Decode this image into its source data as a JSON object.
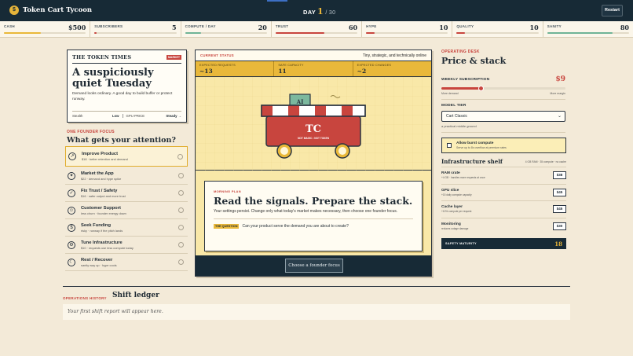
{
  "app": {
    "title": "Token Cart Tycoon",
    "logo_text": "$",
    "day_prefix": "DAY",
    "day_current": "1",
    "day_total": "/ 30",
    "restart_label": "Restart"
  },
  "stats": [
    {
      "label": "CASH",
      "value": "$500",
      "fill": 0.45,
      "color": "#e9b83a"
    },
    {
      "label": "SUBSCRIBERS",
      "value": "5",
      "fill": 0.03,
      "color": "#c8453e"
    },
    {
      "label": "COMPUTE / DAY",
      "value": "20",
      "fill": 0.2,
      "color": "#6fb396"
    },
    {
      "label": "TRUST",
      "value": "60",
      "fill": 0.6,
      "color": "#c8453e"
    },
    {
      "label": "HYPE",
      "value": "10",
      "fill": 0.1,
      "color": "#c8453e"
    },
    {
      "label": "QUALITY",
      "value": "10",
      "fill": 0.1,
      "color": "#c8453e"
    },
    {
      "label": "SANITY",
      "value": "80",
      "fill": 0.8,
      "color": "#6fb396"
    }
  ],
  "news": {
    "paper": "THE TOKEN TIMES",
    "badge": "MARKET",
    "headline": "A suspiciously quiet Tuesday",
    "body": "Demand looks ordinary. A good day to build buffer or protect runway.",
    "f1_label": "Stealth",
    "f1_value": "Low",
    "f2_label": "GPU PRICE",
    "f2_value": "Steady →"
  },
  "focus": {
    "kicker": "ONE FOUNDER FOCUS",
    "title": "What gets your attention?",
    "options": [
      {
        "icon": "↗",
        "icon_name": "trend-up-icon",
        "label": "Improve Product",
        "sub": "$18 · better retention and demand"
      },
      {
        "icon": "✦",
        "icon_name": "sparkle-icon",
        "label": "Market the App",
        "sub": "$22 · demand and hype spike"
      },
      {
        "icon": "✓",
        "icon_name": "check-icon",
        "label": "Fix Trust / Safety",
        "sub": "$16 · safer output and more trust"
      },
      {
        "icon": "☺",
        "icon_name": "smile-icon",
        "label": "Customer Support",
        "sub": "less churn · founder energy down"
      },
      {
        "icon": "$",
        "icon_name": "dollar-icon",
        "label": "Seek Funding",
        "sub": "risky · runway if the pitch lands"
      },
      {
        "icon": "⚙",
        "icon_name": "gear-icon",
        "label": "Tune Infrastructure",
        "sub": "$10 · requests use less compute today"
      },
      {
        "icon": "☾",
        "icon_name": "moon-icon",
        "label": "Rest / Recover",
        "sub": "sanity way up · hype cools"
      }
    ]
  },
  "center": {
    "status": "CURRENT STATUS",
    "tagline": "Tiny, strategic, and technically online",
    "metrics": [
      {
        "label": "EXPECTED REQUESTS",
        "value": "~13"
      },
      {
        "label": "SAFE CAPACITY",
        "value": "11"
      },
      {
        "label": "EXPECTED CHANGES",
        "value": "~2"
      }
    ],
    "cart_logo": "TC",
    "cart_sub": "NOT MAGIC • NOT TOKEN",
    "cart_sign": "AI",
    "plan_kicker": "MORNING PLAN",
    "plan_title": "Read the signals. Prepare the stack.",
    "plan_body": "Your settings persist. Change only what today's market makes necessary, then choose one founder focus.",
    "question_tag": "THE QUESTION",
    "question_text": "Can your product serve the demand you are about to create?",
    "choose_label": "Choose a founder focus"
  },
  "desk": {
    "kicker": "OPERATING DESK",
    "title": "Price & stack",
    "sub_label": "WEEKLY SUBSCRIPTION",
    "sub_price": "$9",
    "sub_level": 0.32,
    "slider_low": "More demand",
    "slider_high": "More margin",
    "tier_label": "MODEL TIER",
    "tier_value": "Cart Classic",
    "tier_note": "a practical middle ground",
    "burst_label": "Allow burst compute",
    "burst_sub": "Serve up to 8x overflow at premium rates",
    "infra_title": "Infrastructure shelf",
    "infra_meta": "4 GB RAM · 35 compute · no cache",
    "infra": [
      {
        "name": "RAM crate",
        "sub": "+4 GB · handles more requests at once",
        "price": "$38"
      },
      {
        "name": "GPU slice",
        "sub": "+15 daily compute capacity",
        "price": "$45"
      },
      {
        "name": "Cache layer",
        "sub": "+10% compute per request",
        "price": "$45"
      },
      {
        "name": "Monitoring",
        "sub": "reduces outage damage",
        "price": "$30"
      }
    ],
    "safety_label": "SAFETY MATURITY",
    "safety_value": "18"
  },
  "history": {
    "kicker": "OPERATIONS HISTORY",
    "title": "Shift ledger",
    "empty": "Your first shift report will appear here."
  }
}
